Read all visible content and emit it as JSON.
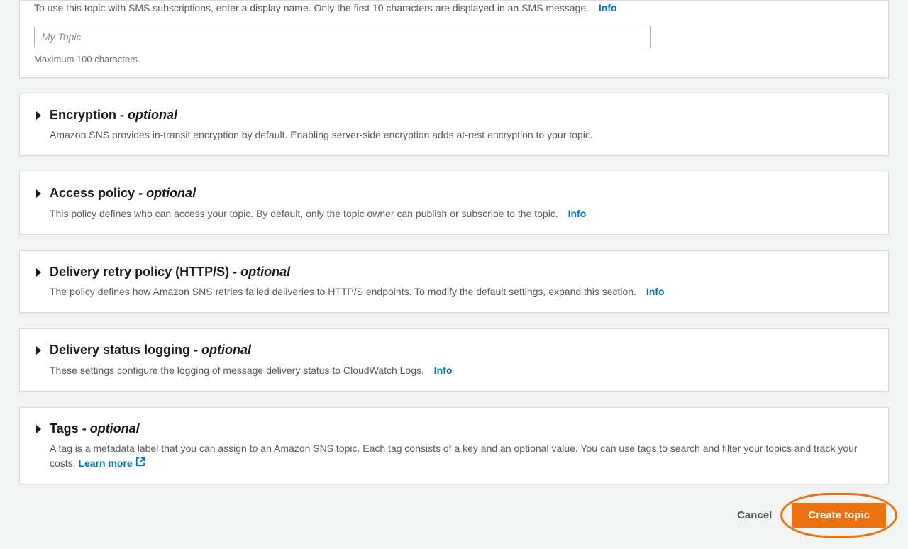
{
  "display_name": {
    "desc": "To use this topic with SMS subscriptions, enter a display name. Only the first 10 characters are displayed in an SMS message.",
    "info": "Info",
    "placeholder": "My Topic",
    "value": "",
    "hint": "Maximum 100 characters."
  },
  "sections": {
    "encryption": {
      "title": "Encryption",
      "optional": "optional",
      "desc": "Amazon SNS provides in-transit encryption by default. Enabling server-side encryption adds at-rest encryption to your topic."
    },
    "access_policy": {
      "title": "Access policy",
      "optional": "optional",
      "desc": "This policy defines who can access your topic. By default, only the topic owner can publish or subscribe to the topic.",
      "info": "Info"
    },
    "delivery_retry": {
      "title": "Delivery retry policy (HTTP/S)",
      "optional": "optional",
      "desc": "The policy defines how Amazon SNS retries failed deliveries to HTTP/S endpoints. To modify the default settings, expand this section.",
      "info": "Info"
    },
    "delivery_status": {
      "title": "Delivery status logging",
      "optional": "optional",
      "desc": "These settings configure the logging of message delivery status to CloudWatch Logs.",
      "info": "Info"
    },
    "tags": {
      "title": "Tags",
      "optional": "optional",
      "desc": "A tag is a metadata label that you can assign to an Amazon SNS topic. Each tag consists of a key and an optional value. You can use tags to search and filter your topics and track your costs.",
      "learn_more": "Learn more"
    }
  },
  "actions": {
    "cancel": "Cancel",
    "create": "Create topic"
  }
}
